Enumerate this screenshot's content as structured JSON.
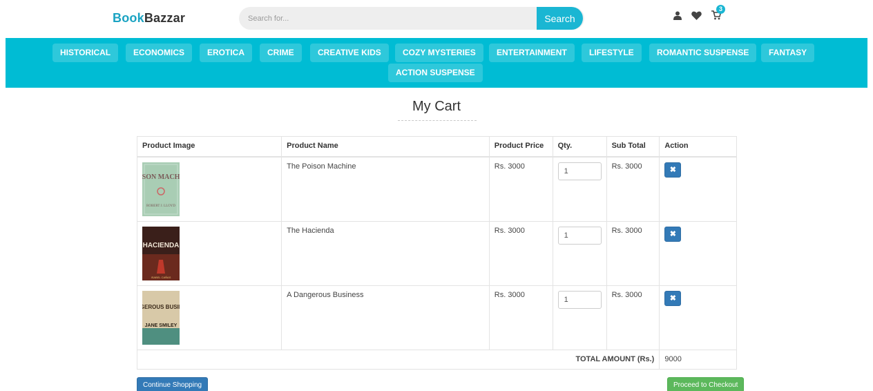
{
  "brand": {
    "part1": "Book",
    "part2": "Bazzar"
  },
  "search": {
    "placeholder": "Search for...",
    "button_label": "Search"
  },
  "header_icons": {
    "user": "user-icon",
    "wishlist": "heart-icon",
    "cart": "cart-icon",
    "cart_count": "3"
  },
  "categories": [
    "HISTORICAL",
    "ECONOMICS",
    "EROTICA",
    "CRIME",
    "CREATIVE KIDS",
    "COZY MYSTERIES",
    "ENTERTAINMENT",
    "LIFESTYLE",
    "ROMANTIC SUSPENSE",
    "FANTASY",
    "ACTION SUSPENSE"
  ],
  "page_title": "My Cart",
  "table": {
    "headers": [
      "Product Image",
      "Product Name",
      "Product Price",
      "Qty.",
      "Sub Total",
      "Action"
    ],
    "rows": [
      {
        "name": "The Poison Machine",
        "price": "Rs. 3000",
        "qty": "1",
        "subtotal": "Rs. 3000",
        "cover": {
          "title": "POISON MACHINE",
          "author": "ROBERT J. LLOYD"
        }
      },
      {
        "name": "The Hacienda",
        "price": "Rs. 3000",
        "qty": "1",
        "subtotal": "Rs. 3000",
        "cover": {
          "title": "HACIENDA",
          "author": "ISABEL CAÑAS"
        }
      },
      {
        "name": "A Dangerous Business",
        "price": "Rs. 3000",
        "qty": "1",
        "subtotal": "Rs. 3000",
        "cover": {
          "title": "DANGEROUS BUSINESS",
          "author": "JANE SMILEY"
        }
      }
    ],
    "total_label": "TOTAL AMOUNT (Rs.)",
    "total_value": "9000"
  },
  "buttons": {
    "continue": "Continue Shopping",
    "checkout": "Proceed to Checkout"
  },
  "colors": {
    "accent": "#00bcd4",
    "primary": "#337ab7",
    "success": "#5cb85c"
  }
}
